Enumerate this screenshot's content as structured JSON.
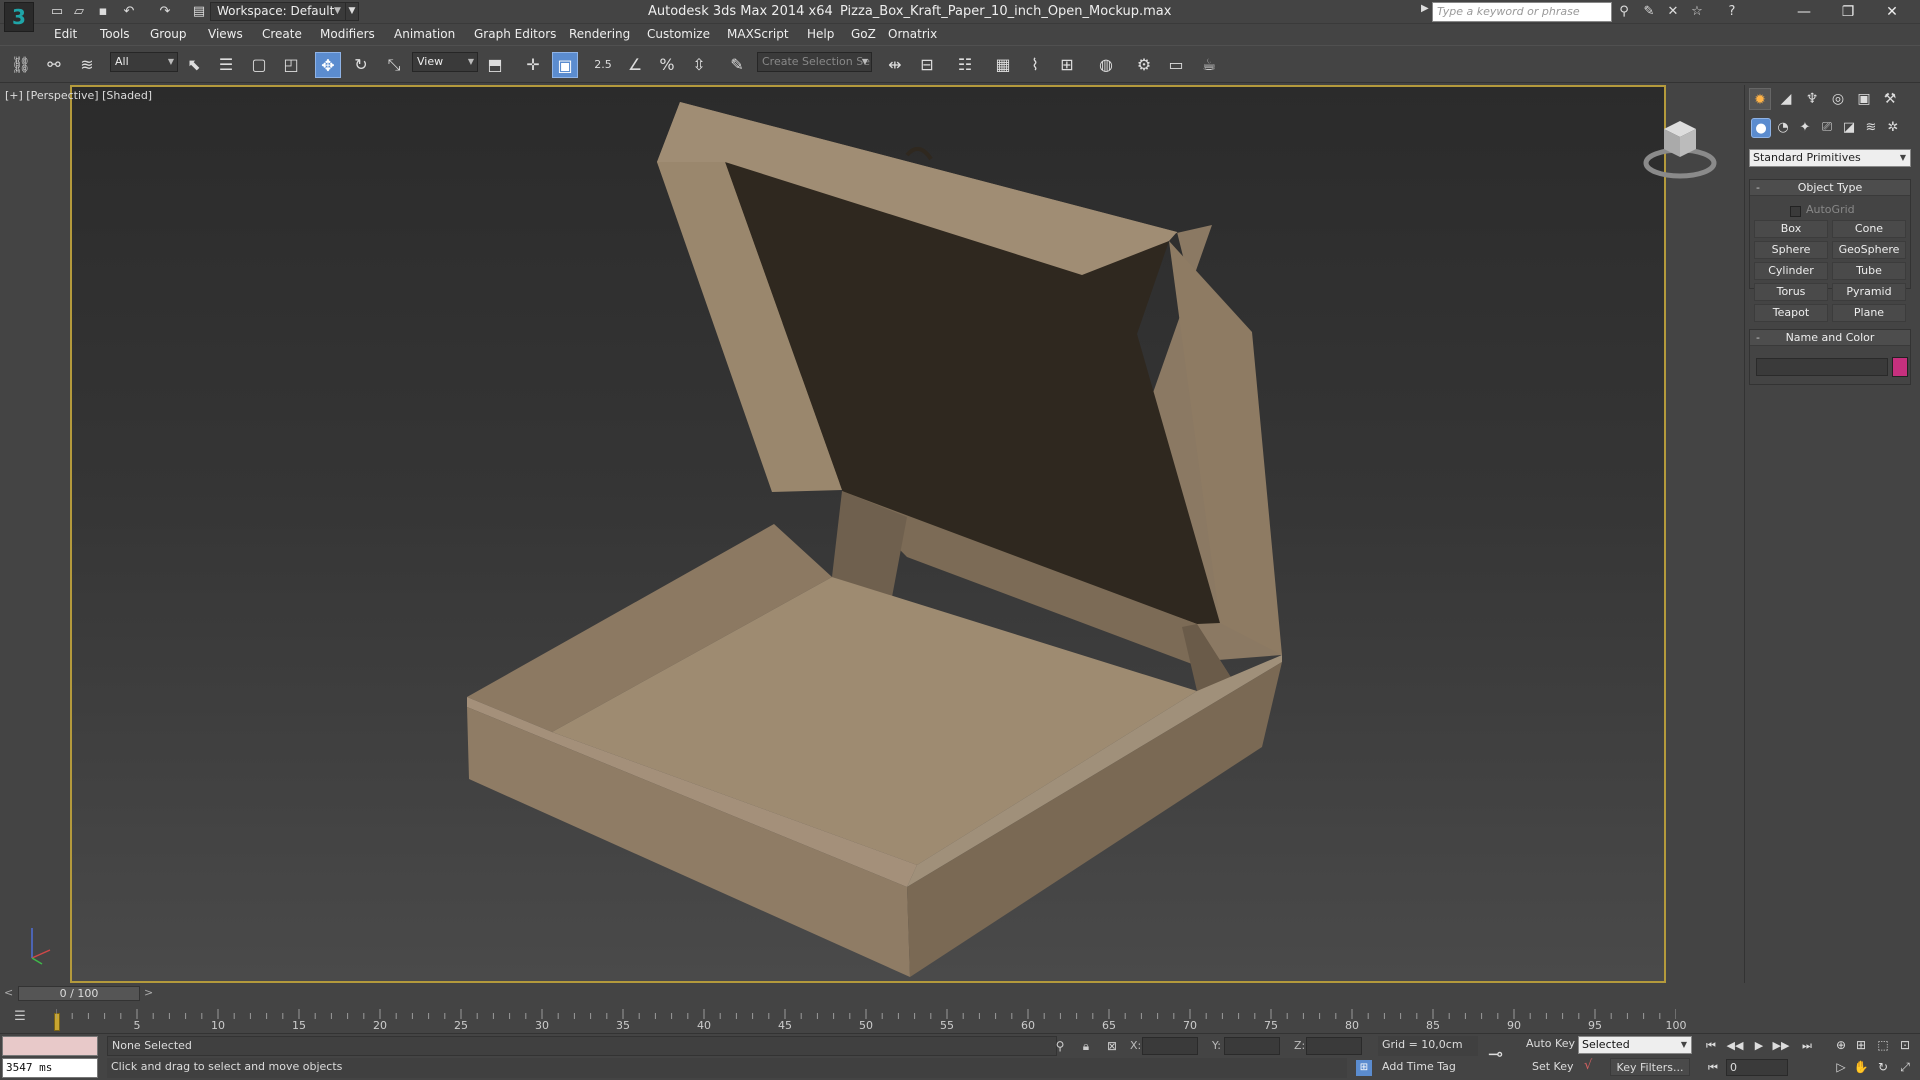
{
  "titlebar": {
    "workspace": "Workspace: Default",
    "app_title": "Autodesk 3ds Max  2014 x64",
    "file_name": "Pizza_Box_Kraft_Paper_10_inch_Open_Mockup.max",
    "search_placeholder": "Type a keyword or phrase"
  },
  "menu": [
    "Edit",
    "Tools",
    "Group",
    "Views",
    "Create",
    "Modifiers",
    "Animation",
    "Graph Editors",
    "Rendering",
    "Customize",
    "MAXScript",
    "Help",
    "GoZ",
    "Ornatrix"
  ],
  "toolbar": {
    "selection_filter": "All",
    "ref_coord": "View",
    "snap_value": "2.5",
    "selection_set": "Create Selection Se"
  },
  "viewport": {
    "label": "[+] [Perspective] [Shaded]"
  },
  "command_panel": {
    "category": "Standard Primitives",
    "object_type_title": "Object Type",
    "autogrid_label": "AutoGrid",
    "buttons": [
      "Box",
      "Cone",
      "Sphere",
      "GeoSphere",
      "Cylinder",
      "Tube",
      "Torus",
      "Pyramid",
      "Teapot",
      "Plane"
    ],
    "name_color_title": "Name and Color",
    "object_color": "#c6307e"
  },
  "timeline": {
    "frame_display": "0 / 100",
    "left_arrow": "<",
    "right_arrow": ">",
    "ticks": [
      "5",
      "10",
      "15",
      "20",
      "25",
      "30",
      "35",
      "40",
      "45",
      "50",
      "55",
      "60",
      "65",
      "70",
      "75",
      "80",
      "85",
      "90",
      "95",
      "100"
    ]
  },
  "status": {
    "timer": "3547 ms",
    "selection": "None Selected",
    "prompt": "Click and drag to select and move objects",
    "x_label": "X:",
    "y_label": "Y:",
    "z_label": "Z:",
    "grid": "Grid = 10,0cm",
    "add_time_tag": "Add Time Tag",
    "auto_key": "Auto Key",
    "set_key": "Set Key",
    "key_mode": "Selected",
    "key_filters": "Key Filters...",
    "current_frame": "0"
  },
  "colors": {
    "accent_border": "#b49a3c",
    "active_tool": "#5b8ccf"
  }
}
